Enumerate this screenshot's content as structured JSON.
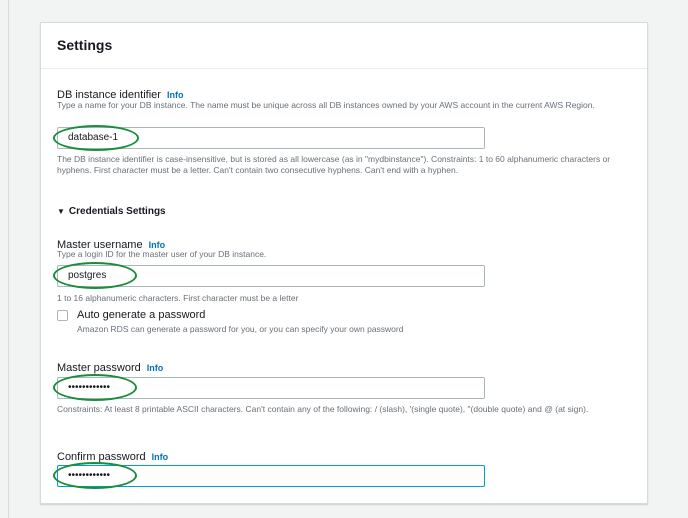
{
  "settings": {
    "title": "Settings",
    "db_identifier": {
      "label": "DB instance identifier",
      "info": "Info",
      "description": "Type a name for your DB instance. The name must be unique across all DB instances owned by your AWS account in the current AWS Region.",
      "value": "database-1",
      "constraints": "The DB instance identifier is case-insensitive, but is stored as all lowercase (as in \"mydbinstance\"). Constraints: 1 to 60 alphanumeric characters or hyphens. First character must be a letter. Can't contain two consecutive hyphens. Can't end with a hyphen."
    },
    "credentials": {
      "toggle_label": "Credentials Settings",
      "master_username": {
        "label": "Master username",
        "info": "Info",
        "description": "Type a login ID for the master user of your DB instance.",
        "value": "postgres",
        "constraints": "1 to 16 alphanumeric characters. First character must be a letter"
      },
      "auto_generate": {
        "label": "Auto generate a password",
        "description": "Amazon RDS can generate a password for you, or you can specify your own password",
        "checked": false
      },
      "master_password": {
        "label": "Master password",
        "info": "Info",
        "value": "••••••••••••",
        "constraints": "Constraints: At least 8 printable ASCII characters. Can't contain any of the following: / (slash), '(single quote), \"(double quote) and @ (at sign)."
      },
      "confirm_password": {
        "label": "Confirm password",
        "info": "Info",
        "value": "••••••••••••"
      }
    }
  },
  "colors": {
    "highlight_ellipse": "#1a8c3a",
    "info_link": "#0073bb",
    "focus_border": "#00a1c9"
  }
}
